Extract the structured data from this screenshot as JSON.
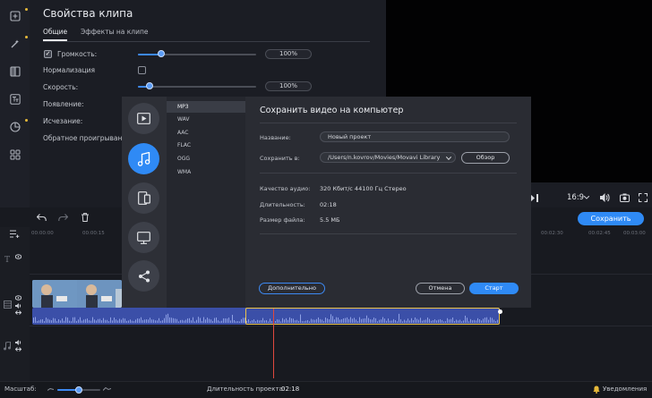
{
  "clip_properties": {
    "title": "Свойства клипа",
    "tabs": [
      "Общие",
      "Эффекты на клипе"
    ],
    "volume_label": "Громкость:",
    "volume_value": "100%",
    "volume_level": 0.2,
    "normalize_label": "Нормализация",
    "speed_label": "Скорость:",
    "speed_value": "100%",
    "speed_level": 0.1,
    "fade_in_label": "Появление:",
    "fade_out_label": "Исчезание:",
    "reverse_label": "Обратное проигрывани"
  },
  "player": {
    "aspect_ratio": "16:9",
    "save_button": "Сохранить"
  },
  "timeline": {
    "ruler_ticks": [
      "00:00:00",
      "00:00:15",
      "00:02:30",
      "00:02:45",
      "00:03:00"
    ]
  },
  "status_bar": {
    "zoom_label": "Масштаб:",
    "duration_label": "Длительность проекта:",
    "duration_value": "02:18",
    "notifications_label": "Уведомления"
  },
  "export": {
    "categories": [
      "video-icon",
      "music-note-icon",
      "devices-icon",
      "tv-icon",
      "share-icon"
    ],
    "active_category": 1,
    "formats": [
      "MP3",
      "WAV",
      "AAC",
      "FLAC",
      "OGG",
      "WMA"
    ],
    "active_format": 0
  },
  "save_dialog": {
    "title": "Сохранить видео на компьютер",
    "name_label": "Название:",
    "name_value": "Новый проект",
    "save_to_label": "Сохранить в:",
    "save_to_value": "/Users/n.kovrov/Movies/Movavi Library",
    "browse_button": "Обзор",
    "audio_quality_label": "Качество аудио:",
    "audio_quality_value": "320 Кбит/с 44100 Гц Стерео",
    "duration_label": "Длительность:",
    "duration_value": "02:18",
    "file_size_label": "Размер файла:",
    "file_size_value": "5.5 МБ",
    "advanced_button": "Дополнительно",
    "cancel_button": "Отмена",
    "start_button": "Старт"
  },
  "colors": {
    "accent": "#2f8af5",
    "selection": "#e9c24a",
    "playhead": "#e0483d",
    "background": "#1b1d24"
  }
}
